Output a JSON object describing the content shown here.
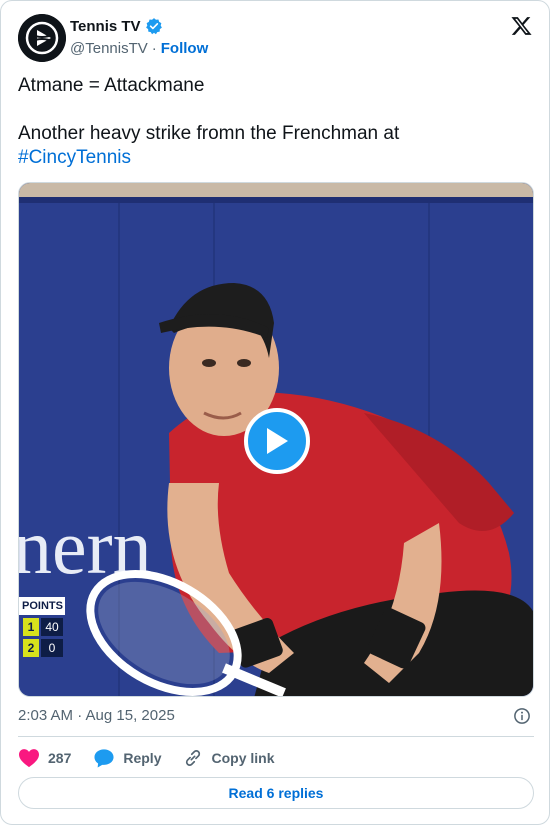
{
  "author": {
    "display_name": "Tennis TV",
    "handle": "@TennisTV",
    "separator": "·",
    "follow_label": "Follow",
    "verified_color": "#1d9bf0",
    "avatar_icon": "tennis-tv-logo"
  },
  "tweet": {
    "line1": "Atmane = Attackmane",
    "line2": "Another heavy strike fromn the Frenchman at",
    "hashtag": "#CincyTennis"
  },
  "media": {
    "type": "video",
    "play_icon": "play-icon",
    "scoreboard": {
      "title": "POINTS",
      "rows": [
        {
          "seed": "1",
          "points": "40"
        },
        {
          "seed": "2",
          "points": "0"
        }
      ]
    }
  },
  "footer": {
    "timestamp": "2:03 AM · Aug 15, 2025",
    "like_count": "287",
    "reply_label": "Reply",
    "copy_link_label": "Copy link",
    "read_replies_label": "Read 6 replies"
  },
  "colors": {
    "link": "#006fd6",
    "like": "#f91880",
    "reply_bubble": "#1d9bf0",
    "muted_text": "#536471",
    "border": "#cfd9de"
  }
}
